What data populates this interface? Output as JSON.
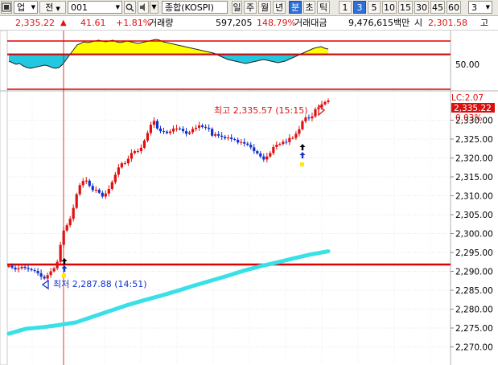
{
  "toolbar": {
    "market_type": "업",
    "jeon_label": "전",
    "code": "001",
    "index_name": "종합(KOSPI)",
    "period_tabs": [
      "일",
      "주",
      "월",
      "년",
      "분",
      "초",
      "틱"
    ],
    "active_period": "분",
    "interval_options": [
      "1",
      "3",
      "5",
      "10",
      "15",
      "30",
      "45",
      "60"
    ],
    "active_interval": "3",
    "interval_input": "3"
  },
  "quote": {
    "price": "2,335.22",
    "change_arrow": "▲",
    "change": "41.61",
    "change_pct": "+1.81%",
    "volume_label": "거래량",
    "volume": "597,205",
    "volume_ratio": "148.79%",
    "amount_label": "거래대금",
    "amount": "9,476,615백만",
    "open_label": "시",
    "open": "2,301.58",
    "high_label": "고"
  },
  "oscillator": {
    "axis_label": "50.00"
  },
  "price_axis": {
    "lc_label": "LC:2.07",
    "current_price": "2,335.22",
    "current_pct": "0.03%",
    "ticks": [
      "2,330.00",
      "2,325.00",
      "2,320.00",
      "2,315.00",
      "2,310.00",
      "2,305.00",
      "2,300.00",
      "2,295.00",
      "2,290.00",
      "2,285.00",
      "2,280.00",
      "2,275.00",
      "2,270.00"
    ]
  },
  "annotations": {
    "high": "최고 2,335.57 (15:15)",
    "low": "최저 2,287.88 (14:51)"
  },
  "colors": {
    "up_candle": "#e01010",
    "down_candle": "#1030d0",
    "moving_average": "#39e0e8",
    "guide_line": "#e00000",
    "osc_positive": "#ffff00",
    "osc_negative": "#22c8e0"
  },
  "chart_data": {
    "type": "line",
    "title": "",
    "xlabel": "",
    "ylabel": "",
    "ylim": [
      2268,
      2337
    ],
    "series": [
      {
        "values": [
          2291.5,
          2291.0,
          2290.5,
          2290.8,
          2291.2,
          2290.9,
          2290.6,
          2290.3,
          2290.1,
          2289.5,
          2288.6,
          2288.1,
          2289.0,
          2290.0,
          2290.8,
          2292.5,
          2297.0,
          2300.8,
          2302.2,
          2303.9,
          2306.8,
          2310.4,
          2312.8,
          2313.9,
          2314.0,
          2312.6,
          2311.5,
          2311.6,
          2310.8,
          2309.8,
          2310.6,
          2311.8,
          2313.6,
          2315.6,
          2317.5,
          2318.6,
          2318.6,
          2319.8,
          2321.3,
          2321.8,
          2321.8,
          2322.7,
          2324.6,
          2326.6,
          2328.8,
          2329.8,
          2327.8,
          2327.1,
          2327.0,
          2326.6,
          2327.0,
          2327.8,
          2327.8,
          2327.7,
          2327.1,
          2326.4,
          2326.8,
          2327.7,
          2328.0,
          2328.6,
          2328.2,
          2328.0,
          2327.7,
          2325.9,
          2326.3,
          2325.9,
          2325.6,
          2325.2,
          2325.4,
          2325.0,
          2324.8,
          2324.1,
          2324.2,
          2323.8,
          2323.5,
          2322.8,
          2321.8,
          2321.2,
          2320.4,
          2319.6,
          2320.4,
          2321.3,
          2322.9,
          2323.5,
          2323.7,
          2324.3,
          2324.2,
          2325.3,
          2325.3,
          2326.4,
          2327.6,
          2329.7,
          2330.7,
          2330.5,
          2331.0,
          2332.9,
          2333.4,
          2334.2,
          2334.8,
          2335.2
        ]
      },
      {
        "values": [
          2273.5,
          2274.8,
          2275.2,
          2275.8,
          2276.5,
          2278.0,
          2279.5,
          2281.0,
          2282.3,
          2283.5,
          2284.8,
          2286.2,
          2287.5,
          2288.8,
          2290.2,
          2291.4,
          2292.4,
          2293.5,
          2294.5,
          2295.3
        ]
      }
    ],
    "annotations": {
      "high": {
        "value": 2335.57,
        "time": "15:15"
      },
      "low": {
        "value": 2287.88,
        "time": "14:51"
      }
    }
  }
}
